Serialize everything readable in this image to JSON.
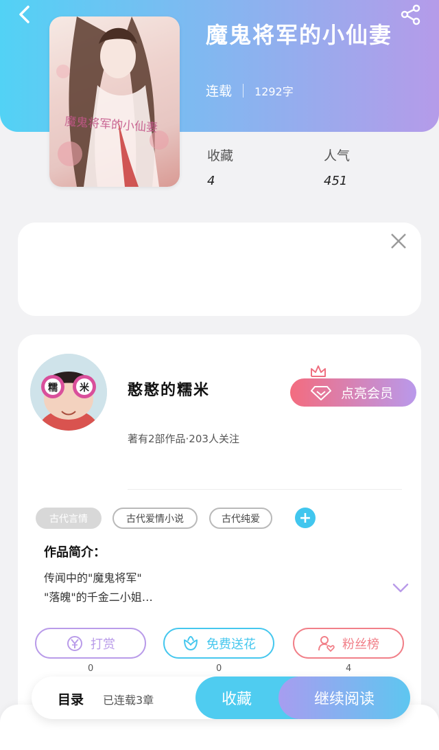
{
  "book": {
    "title": "魔鬼将军的小仙妻",
    "status": "连载",
    "word_count": "1292字",
    "cover_caption": "魔鬼将军的小仙妻"
  },
  "stats": [
    {
      "label": "收藏",
      "value": "4"
    },
    {
      "label": "人气",
      "value": "451"
    }
  ],
  "author": {
    "name": "憨憨的糯米",
    "sub": "著有2部作品·203人关注",
    "avatar_text": [
      "糯",
      "米"
    ],
    "vip_label": "点亮会员"
  },
  "tags": [
    "古代言情",
    "古代爱情小说",
    "古代纯爱"
  ],
  "intro": {
    "title": "作品简介：",
    "lines": [
      "传闻中的\"魔鬼将军\"",
      "\"落魄\"的千金二小姐…"
    ]
  },
  "actions": [
    {
      "label": "打赏",
      "count": "0",
      "icon": "yen-icon",
      "color": "#b99be9"
    },
    {
      "label": "免费送花",
      "count": "0",
      "icon": "flower-icon",
      "color": "#45c7ee"
    },
    {
      "label": "粉丝榜",
      "count": "4",
      "icon": "fan-icon",
      "color": "#f17f88"
    }
  ],
  "bottom": {
    "toc_label": "目录",
    "serial_label": "已连载3章",
    "favorite_label": "收藏",
    "read_label": "继续阅读"
  },
  "colors": {
    "accent_blue": "#4fccf0",
    "accent_purple": "#b59be9",
    "accent_pink": "#f36c7f"
  }
}
